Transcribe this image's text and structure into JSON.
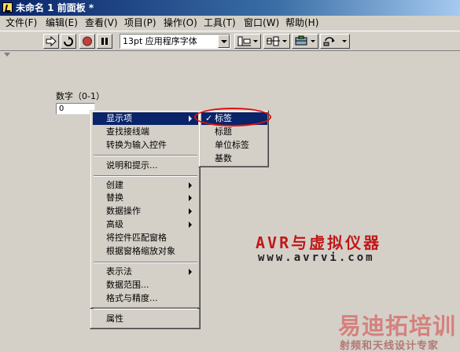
{
  "window": {
    "title": "未命名 1 前面板 *"
  },
  "menubar": [
    {
      "label": "文件(F)"
    },
    {
      "label": "编辑(E)"
    },
    {
      "label": "查看(V)"
    },
    {
      "label": "项目(P)"
    },
    {
      "label": "操作(O)"
    },
    {
      "label": "工具(T)"
    },
    {
      "label": "窗口(W)"
    },
    {
      "label": "帮助(H)"
    }
  ],
  "toolbar": {
    "buttons": [
      {
        "icon": "run-arrow-icon"
      },
      {
        "icon": "run-continuously-icon"
      },
      {
        "icon": "abort-icon"
      },
      {
        "icon": "pause-icon"
      }
    ],
    "font_select": {
      "value": "13pt 应用程序字体"
    },
    "tools": [
      {
        "icon": "align-objects-icon"
      },
      {
        "icon": "distribute-objects-icon"
      },
      {
        "icon": "resize-objects-icon"
      },
      {
        "icon": "reorder-icon"
      }
    ]
  },
  "panel": {
    "numeric_label": "数字（0-1）",
    "numeric_value": "0"
  },
  "context_menu": {
    "items": [
      {
        "label": "显示项",
        "submenu": true,
        "active": true
      },
      {
        "label": "查找接线端"
      },
      {
        "label": "转换为输入控件"
      },
      {
        "label": "说明和提示..."
      },
      {
        "label": "创建",
        "submenu": true
      },
      {
        "label": "替换",
        "submenu": true
      },
      {
        "label": "数据操作",
        "submenu": true
      },
      {
        "label": "高级",
        "submenu": true
      },
      {
        "label": "将控件匹配窗格"
      },
      {
        "label": "根据窗格缩放对象"
      },
      {
        "label": "表示法",
        "submenu": true
      },
      {
        "label": "数据范围..."
      },
      {
        "label": "格式与精度..."
      },
      {
        "label": "属性"
      }
    ]
  },
  "submenu": {
    "items": [
      {
        "label": "标签",
        "checked": true,
        "active": true
      },
      {
        "label": "标题"
      },
      {
        "label": "单位标签"
      },
      {
        "label": "基数"
      }
    ]
  },
  "watermarks": {
    "line1": "AVR与虚拟仪器",
    "line2": "www.avrvi.com",
    "line3": "易迪拓培训",
    "line4": "射频和天线设计专家"
  },
  "colors": {
    "highlight": "#0a246a",
    "ellipse": "#e01010",
    "face": "#d4d0c8"
  }
}
